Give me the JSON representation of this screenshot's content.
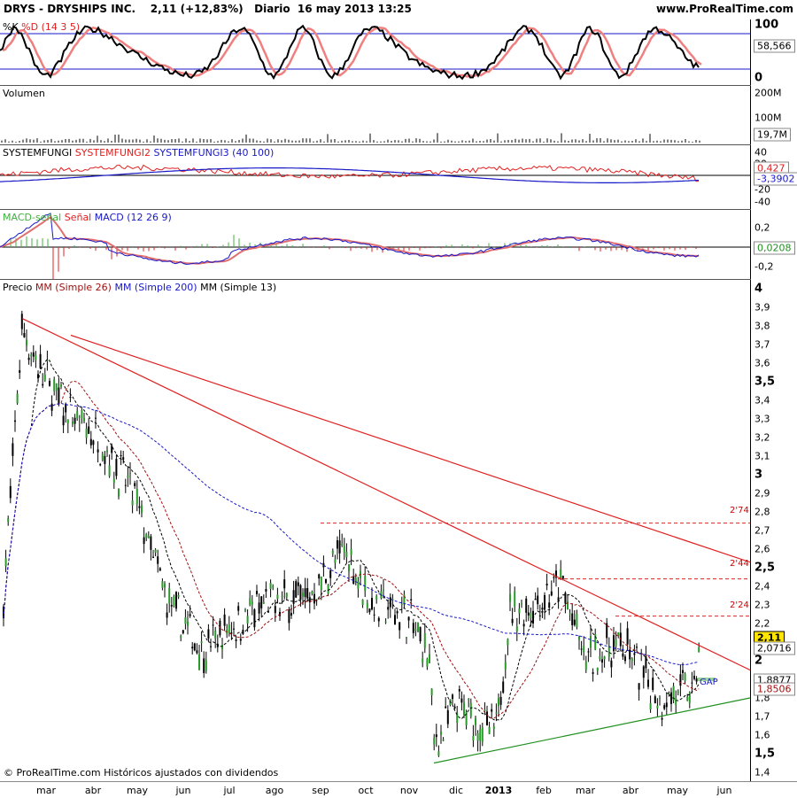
{
  "header": {
    "ticker_line": "DRYS - DRYSHIPS INC.    2,11 (+12,83%)   Diario  16 may 2013 13:25",
    "site": "www.ProRealTime.com"
  },
  "footer": {
    "copyright": "© ProRealTime.com Históricos ajustados con dividendos"
  },
  "colors": {
    "red": "#e02020",
    "blue": "#1818c8",
    "green": "#209020",
    "black": "#000000"
  },
  "panels": {
    "stochastic": {
      "label_k": "%K",
      "label_d": "%D",
      "label_params": "(14 3 5)",
      "ticks": [
        "100",
        "0"
      ],
      "value": "58,566"
    },
    "volume": {
      "label": "Volumen",
      "ticks": [
        "200M",
        "100M"
      ],
      "value": "19,7M"
    },
    "systemfungi": {
      "label1": "SYSTEMFUNGI",
      "label2": "SYSTEMFUNGI2",
      "label3": "SYSTEMFUNGI3",
      "params": "(40 100)",
      "ticks": [
        "40",
        "20",
        "0",
        "-20",
        "-40"
      ],
      "values": [
        "0,427",
        "-3,3902"
      ]
    },
    "macd": {
      "label1": "MACD-señal",
      "label2": "Señal",
      "label3": "MACD",
      "params": "(12 26 9)",
      "ticks": [
        "0,2",
        "0",
        "-0,2"
      ],
      "value": "0,0208"
    },
    "price": {
      "label_prefix": "Precio",
      "ma1": "MM (Simple 26)",
      "ma2": "MM (Simple 200)",
      "ma3": "MM (Simple 13)",
      "ticks": [
        "4",
        "3,9",
        "3,8",
        "3,7",
        "3,6",
        "3,5",
        "3,4",
        "3,3",
        "3,2",
        "3,1",
        "3",
        "2,9",
        "2,8",
        "2,7",
        "2,6",
        "2,5",
        "2,4",
        "2,3",
        "2,2",
        "2,1",
        "2",
        "1,9",
        "1,8",
        "1,7",
        "1,6",
        "1,5",
        "1,4"
      ],
      "value_last": "2,11",
      "value_ma200": "2,0716",
      "value_ma13": "1,8877",
      "value_ma26": "1,8506",
      "level_labels": [
        "2'74",
        "2'44",
        "2'24"
      ],
      "gap_label": "GAP"
    }
  },
  "xaxis": [
    "mar",
    "abr",
    "may",
    "jun",
    "jul",
    "ago",
    "sep",
    "oct",
    "nov",
    "dic",
    "2013",
    "feb",
    "mar",
    "abr",
    "may",
    "jun"
  ],
  "chart_data": {
    "type": "line",
    "title": "DRYS - DRYSHIPS INC.",
    "x": [
      "mar",
      "abr",
      "may",
      "jun",
      "jul",
      "ago",
      "sep",
      "oct",
      "nov",
      "dic",
      "2013",
      "feb",
      "mar",
      "abr",
      "may",
      "jun"
    ],
    "series": [
      {
        "name": "Precio",
        "values": [
          2.2,
          3.8,
          3.6,
          3.3,
          3.2,
          2.9,
          2.3,
          2.05,
          2.2,
          2.3,
          2.35,
          2.6,
          2.3,
          2.25,
          2.0,
          1.55,
          1.75,
          1.6,
          2.25,
          2.3,
          2.4,
          2.0,
          2.1,
          1.8,
          1.85,
          2.11
        ]
      },
      {
        "name": "MM (Simple 200)",
        "values": [
          3.1,
          2.95,
          2.85,
          2.75,
          2.65,
          2.55,
          2.5,
          2.45,
          2.3,
          2.2,
          2.1,
          2.07
        ]
      }
    ],
    "ylim": [
      1.4,
      4.0
    ],
    "ylabel": "",
    "xlabel": "",
    "annotations": [
      "2'74",
      "2'44",
      "2'24",
      "GAP"
    ],
    "levels": [
      2.74,
      2.44,
      2.24
    ],
    "grid": false
  }
}
